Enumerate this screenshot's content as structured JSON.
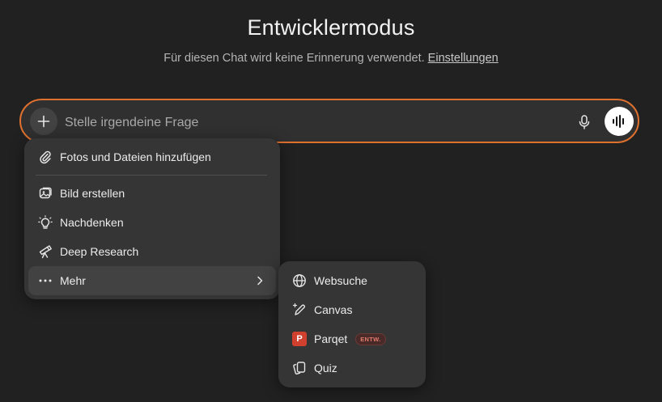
{
  "header": {
    "title": "Entwicklermodus",
    "subtitle_text": "Für diesen Chat wird keine Erinnerung verwendet.",
    "subtitle_link": "Einstellungen"
  },
  "composer": {
    "placeholder": "Stelle irgendeine Frage",
    "value": ""
  },
  "menu": {
    "items": [
      {
        "label": "Fotos und Dateien hinzufügen",
        "icon": "paperclip-icon"
      },
      {
        "label": "Bild erstellen",
        "icon": "image-icon"
      },
      {
        "label": "Nachdenken",
        "icon": "lightbulb-icon"
      },
      {
        "label": "Deep Research",
        "icon": "telescope-icon"
      },
      {
        "label": "Mehr",
        "icon": "more-icon"
      }
    ]
  },
  "submenu": {
    "items": [
      {
        "label": "Websuche",
        "icon": "globe-icon"
      },
      {
        "label": "Canvas",
        "icon": "pen-sparkle-icon"
      },
      {
        "label": "Parqet",
        "icon": "parqet-logo",
        "badge_letter": "P",
        "tag": "ENTW."
      },
      {
        "label": "Quiz",
        "icon": "cards-icon"
      }
    ]
  },
  "colors": {
    "background": "#212121",
    "composer_border": "#e0702e",
    "menu_bg": "#353535",
    "parqet_red": "#d0402e"
  }
}
